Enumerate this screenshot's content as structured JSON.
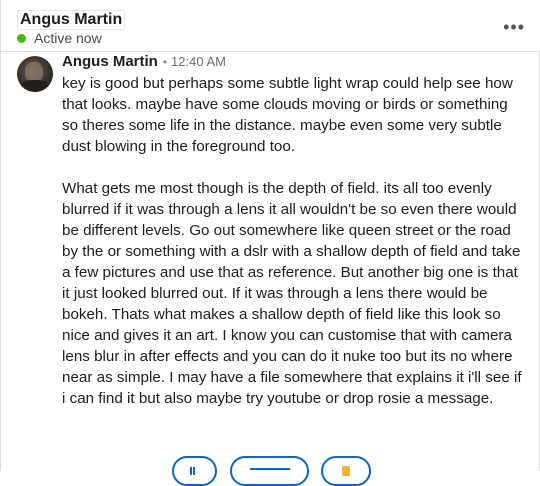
{
  "header": {
    "name": "Angus Martin",
    "status": "Active now",
    "more_icon": "more-horizontal-icon",
    "status_color": "#44b700"
  },
  "message": {
    "author": "Angus Martin",
    "separator": "•",
    "time": "12:40 AM",
    "paragraphs": [
      "key is good but perhaps some subtle light wrap could help see how that looks. maybe have some clouds moving or birds or something so theres some life in the distance. maybe even some very subtle dust blowing in the foreground too.",
      "What gets me most though is the depth of field. its all too evenly blurred if it was through a lens it all wouldn't be so even there would be different levels. Go out somewhere like queen street or the road by the or something with a dslr with a shallow depth of field and take a few pictures and use that as reference. But another big one is that it just looked blurred out. If it was through a lens there would be bokeh. Thats what makes a shallow depth of field like this look so nice and gives it an art. I know you can customise that with camera lens blur in after effects and you can do it nuke too but its no where near as simple. I may have a file somewhere that explains it i'll see if i can find it but also maybe try youtube or drop rosie a message."
    ]
  },
  "reactions": {
    "accent_color": "#0a66c2",
    "items": [
      {
        "icon": "clap-icon"
      },
      {
        "icon": "reaction-label-icon"
      },
      {
        "icon": "thumbs-up-icon"
      }
    ]
  }
}
